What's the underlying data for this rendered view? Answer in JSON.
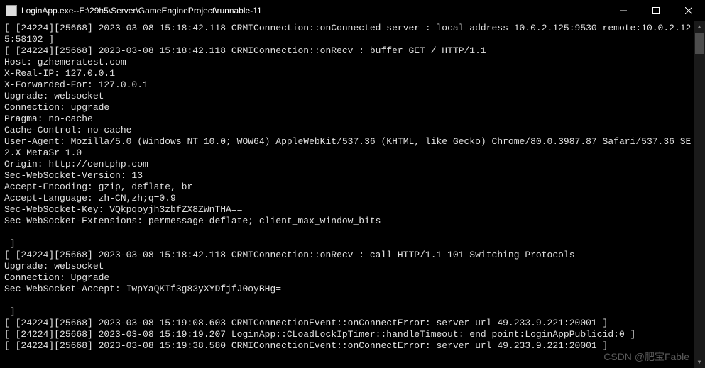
{
  "window": {
    "title": "LoginApp.exe--E:\\29h5\\Server\\GameEngineProject\\runnable-11"
  },
  "log": {
    "lines": [
      "[ [24224][25668] 2023-03-08 15:18:42.118 CRMIConnection::onConnected server : local address 10.0.2.125:9530 remote:10.0.2.125:58102 ]",
      "[ [24224][25668] 2023-03-08 15:18:42.118 CRMIConnection::onRecv : buffer GET / HTTP/1.1",
      "Host: gzhemeratest.com",
      "X-Real-IP: 127.0.0.1",
      "X-Forwarded-For: 127.0.0.1",
      "Upgrade: websocket",
      "Connection: upgrade",
      "Pragma: no-cache",
      "Cache-Control: no-cache",
      "User-Agent: Mozilla/5.0 (Windows NT 10.0; WOW64) AppleWebKit/537.36 (KHTML, like Gecko) Chrome/80.0.3987.87 Safari/537.36 SE 2.X MetaSr 1.0",
      "Origin: http://centphp.com",
      "Sec-WebSocket-Version: 13",
      "Accept-Encoding: gzip, deflate, br",
      "Accept-Language: zh-CN,zh;q=0.9",
      "Sec-WebSocket-Key: VQkpqoyjh3zbfZX8ZWnTHA==",
      "Sec-WebSocket-Extensions: permessage-deflate; client_max_window_bits",
      "",
      " ]",
      "[ [24224][25668] 2023-03-08 15:18:42.118 CRMIConnection::onRecv : call HTTP/1.1 101 Switching Protocols",
      "Upgrade: websocket",
      "Connection: Upgrade",
      "Sec-WebSocket-Accept: IwpYaQKIf3g83yXYDfjfJ0oyBHg=",
      "",
      " ]",
      "[ [24224][25668] 2023-03-08 15:19:08.603 CRMIConnectionEvent::onConnectError: server url 49.233.9.221:20001 ]",
      "[ [24224][25668] 2023-03-08 15:19:19.207 LoginApp::CLoadLockIpTimer::handleTimeout: end point:LoginAppPublicid:0 ]",
      "[ [24224][25668] 2023-03-08 15:19:38.580 CRMIConnectionEvent::onConnectError: server url 49.233.9.221:20001 ]"
    ]
  },
  "watermark": "CSDN @肥宝Fable"
}
